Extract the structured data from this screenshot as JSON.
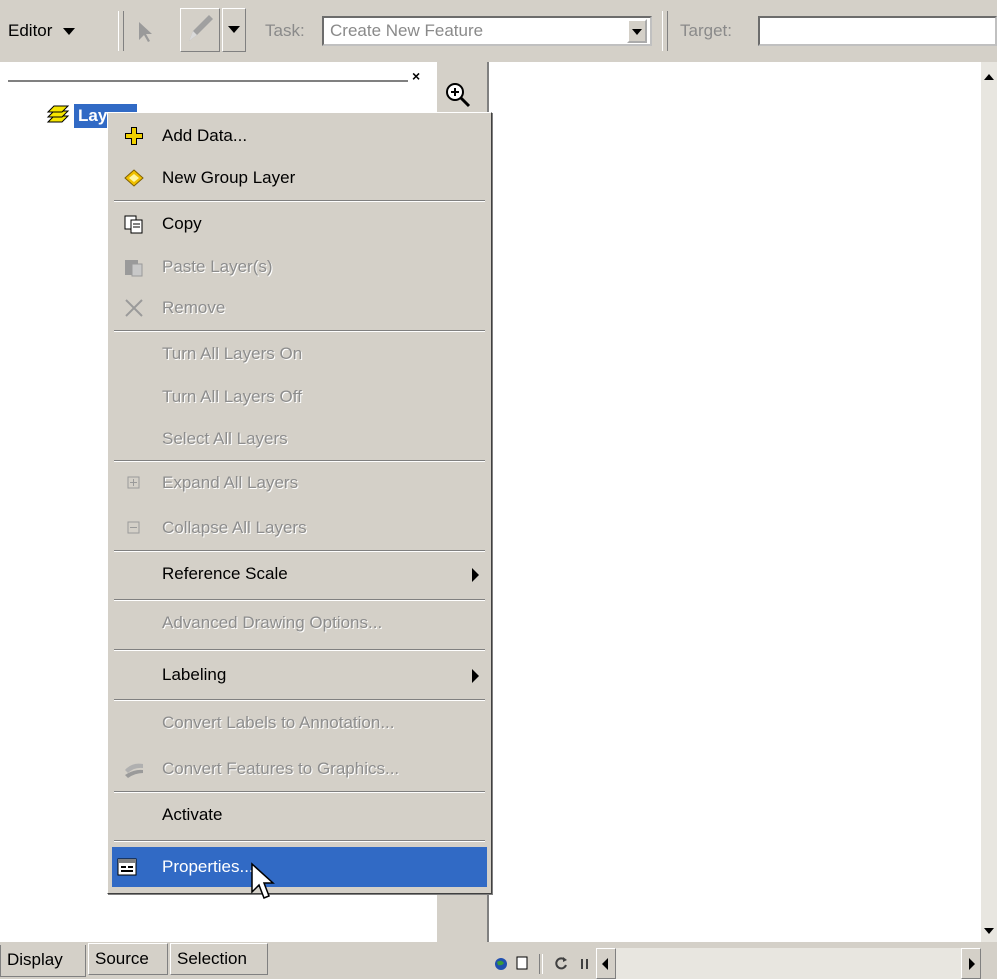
{
  "toolbar": {
    "editor_label": "Editor",
    "task_label": "Task:",
    "task_value": "Create New Feature",
    "target_label": "Target:"
  },
  "toc": {
    "root_label": "Layers"
  },
  "menu": {
    "items": [
      {
        "label": "Add Data...",
        "icon": "add-data-icon",
        "enabled": true
      },
      {
        "label": "New Group Layer",
        "icon": "group-layer-icon",
        "enabled": true
      },
      {
        "label": "Copy",
        "icon": "copy-icon",
        "enabled": true
      },
      {
        "label": "Paste Layer(s)",
        "icon": "paste-icon",
        "enabled": false
      },
      {
        "label": "Remove",
        "icon": "remove-icon",
        "enabled": false
      },
      {
        "label": "Turn All Layers On",
        "enabled": false
      },
      {
        "label": "Turn All Layers Off",
        "enabled": false
      },
      {
        "label": "Select All Layers",
        "enabled": false
      },
      {
        "label": "Expand All Layers",
        "icon": "expand-icon",
        "enabled": false
      },
      {
        "label": "Collapse All Layers",
        "icon": "collapse-icon",
        "enabled": false
      },
      {
        "label": "Reference Scale",
        "submenu": true,
        "enabled": true
      },
      {
        "label": "Advanced Drawing Options...",
        "enabled": false
      },
      {
        "label": "Labeling",
        "submenu": true,
        "enabled": true
      },
      {
        "label": "Convert Labels to Annotation...",
        "enabled": false
      },
      {
        "label": "Convert Features to Graphics...",
        "icon": "convert-graphics-icon",
        "enabled": false
      },
      {
        "label": "Activate",
        "enabled": true
      },
      {
        "label": "Properties...",
        "icon": "properties-icon",
        "enabled": true,
        "selected": true
      }
    ]
  },
  "bottom_tabs": [
    "Display",
    "Source",
    "Selection"
  ],
  "colors": {
    "face": "#d4d0c8",
    "selection": "#316ac5",
    "disabled_text": "#8d8d8d"
  }
}
